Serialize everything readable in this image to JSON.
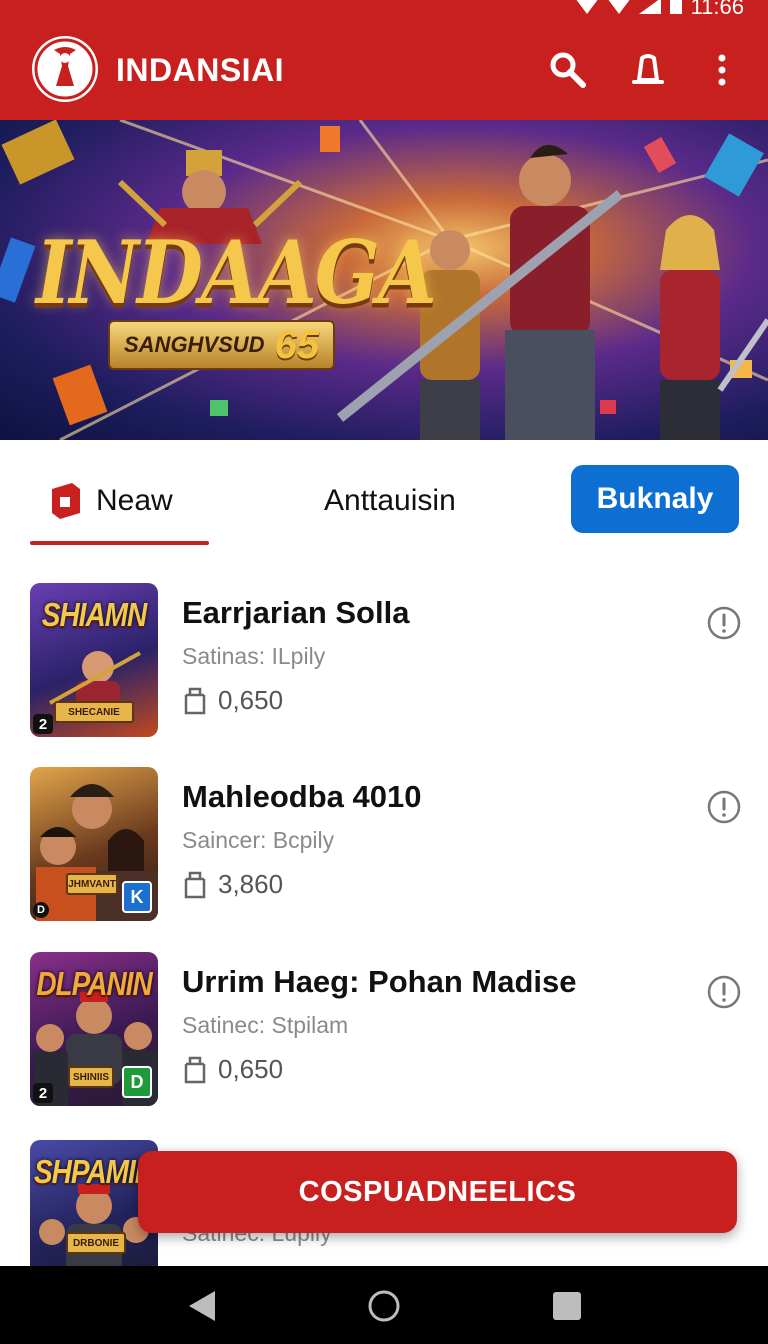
{
  "status_bar": {
    "time": "11:66"
  },
  "app_bar": {
    "title": "INDANSIAI",
    "icons": [
      "search-icon",
      "bell-icon",
      "more-vert-icon"
    ]
  },
  "hero": {
    "title": "INDAAGA",
    "subtitle": "SANGHVSUD",
    "number": "65"
  },
  "tabs": {
    "new_label": "Neaw",
    "all_label": "Anttauisin",
    "button_label": "Buknaly",
    "active": "new"
  },
  "games": [
    {
      "title": "Earrjarian Solla",
      "subtitle": "Satinas: ILpily",
      "downloads": "0,650",
      "thumb_text": "SHIAMN",
      "thumb_number": "2",
      "thumb_badge": "",
      "thumb_plate": "SHECANIE"
    },
    {
      "title": "Mahleodba 4010",
      "subtitle": "Saincer: Bcpily",
      "downloads": "3,860",
      "thumb_text": "",
      "thumb_number": "D",
      "thumb_badge": "K",
      "thumb_plate": "JHMVANT"
    },
    {
      "title": "Urrim Haeg: Pohan Madise",
      "subtitle": "Satinec: Stpilam",
      "downloads": "0,650",
      "thumb_text": "DLPANIN",
      "thumb_number": "2",
      "thumb_badge": "D",
      "thumb_plate": "SHINIIS"
    },
    {
      "title": "",
      "subtitle": "Satinec: Lupily",
      "downloads": "",
      "thumb_text": "SHPAMIN",
      "thumb_number": "",
      "thumb_badge": "",
      "thumb_plate": "DRBONIE"
    }
  ],
  "cta": {
    "label": "COSPUADNEELICS"
  },
  "colors": {
    "primary_red": "#c8201f",
    "accent_blue": "#0d6fd1"
  }
}
